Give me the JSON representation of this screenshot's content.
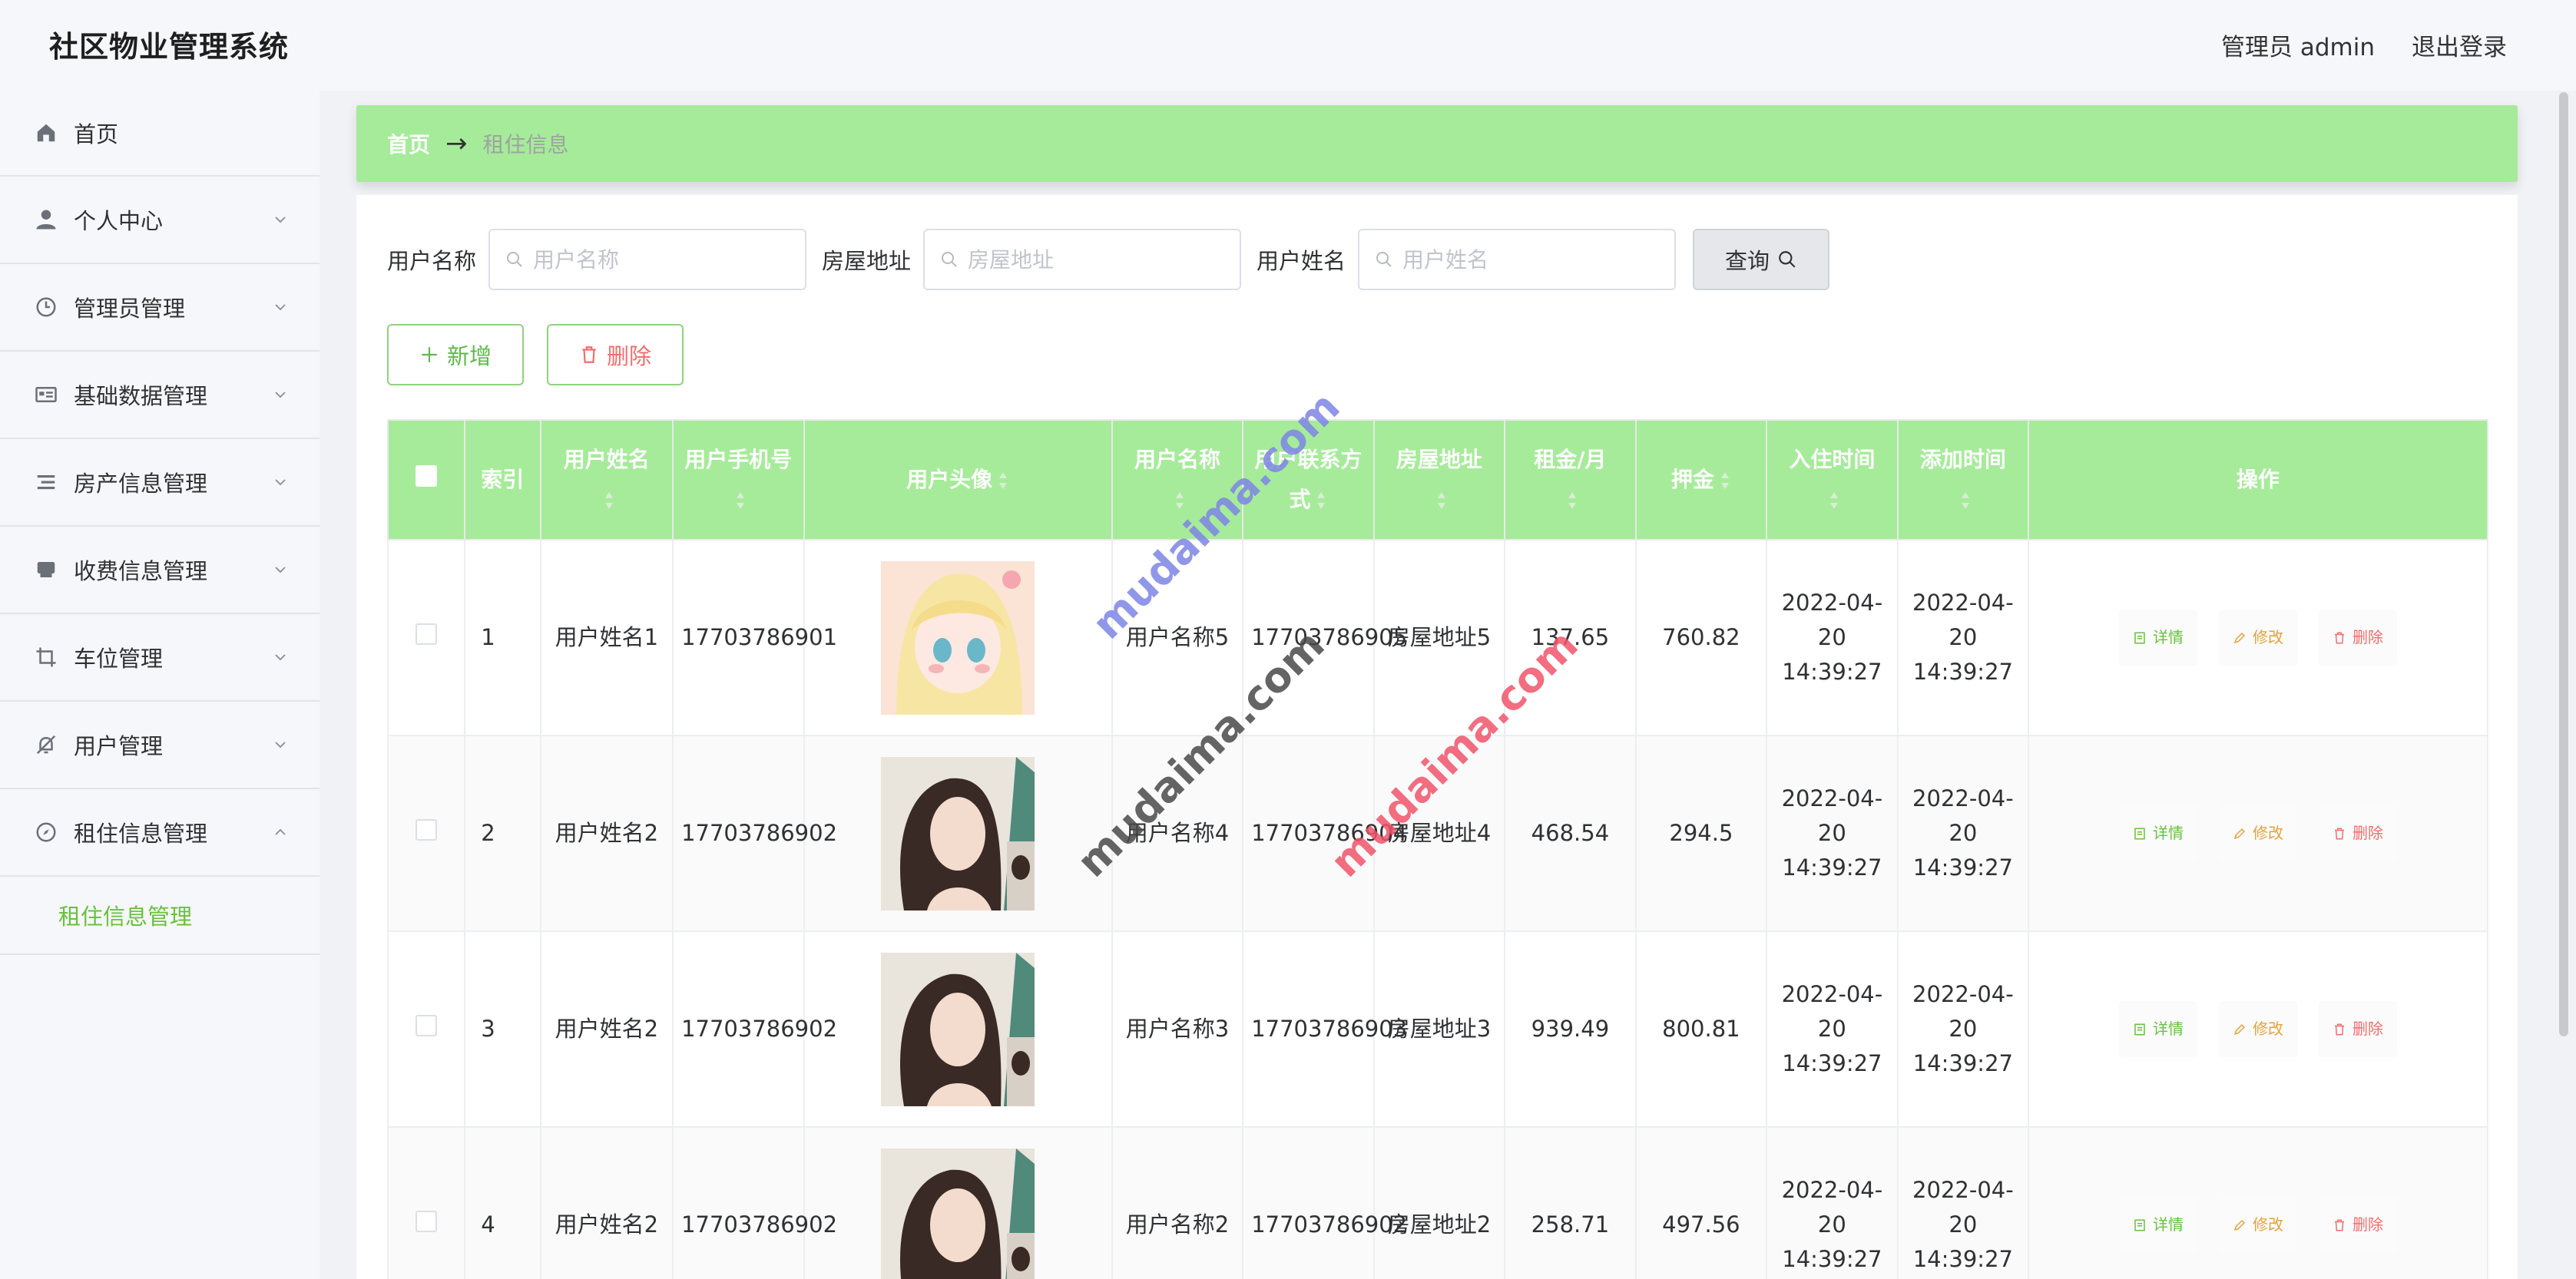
{
  "header": {
    "app_title": "社区物业管理系统",
    "user_label": "管理员 admin",
    "logout_label": "退出登录"
  },
  "sidebar": {
    "items": [
      {
        "label": "首页",
        "icon": "home-icon"
      },
      {
        "label": "个人中心",
        "icon": "user-icon"
      },
      {
        "label": "管理员管理",
        "icon": "clock-icon"
      },
      {
        "label": "基础数据管理",
        "icon": "id-card-icon"
      },
      {
        "label": "房产信息管理",
        "icon": "list-icon"
      },
      {
        "label": "收费信息管理",
        "icon": "printer-icon"
      },
      {
        "label": "车位管理",
        "icon": "crop-icon"
      },
      {
        "label": "用户管理",
        "icon": "bell-off-icon"
      },
      {
        "label": "租住信息管理",
        "icon": "compass-icon"
      }
    ],
    "sub_item": "租住信息管理"
  },
  "breadcrumb": {
    "home": "首页",
    "current": "租住信息"
  },
  "search": {
    "user_name_label": "用户名称",
    "user_name_placeholder": "用户名称",
    "address_label": "房屋地址",
    "address_placeholder": "房屋地址",
    "real_name_label": "用户姓名",
    "real_name_placeholder": "用户姓名",
    "query_label": "查询"
  },
  "actions": {
    "add_label": "新增",
    "delete_label": "删除"
  },
  "table": {
    "columns": {
      "index": "索引",
      "real_name": "用户姓名",
      "phone": "用户手机号",
      "avatar": "用户头像",
      "user_name": "用户名称",
      "contact": "用户联系方式",
      "address": "房屋地址",
      "rent": "租金/月",
      "deposit": "押金",
      "checkin": "入住时间",
      "added": "添加时间",
      "ops": "操作"
    },
    "rows": [
      {
        "index": "1",
        "real_name": "用户姓名1",
        "phone": "17703786901",
        "user_name": "用户名称5",
        "contact": "17703786905",
        "address": "房屋地址5",
        "rent": "137.65",
        "deposit": "760.82",
        "checkin": "2022-04-20 14:39:27",
        "added": "2022-04-20 14:39:27",
        "avatar": "anime-avatar"
      },
      {
        "index": "2",
        "real_name": "用户姓名2",
        "phone": "17703786902",
        "user_name": "用户名称4",
        "contact": "17703786904",
        "address": "房屋地址4",
        "rent": "468.54",
        "deposit": "294.5",
        "checkin": "2022-04-20 14:39:27",
        "added": "2022-04-20 14:39:27",
        "avatar": "portrait-avatar"
      },
      {
        "index": "3",
        "real_name": "用户姓名2",
        "phone": "17703786902",
        "user_name": "用户名称3",
        "contact": "17703786903",
        "address": "房屋地址3",
        "rent": "939.49",
        "deposit": "800.81",
        "checkin": "2022-04-20 14:39:27",
        "added": "2022-04-20 14:39:27",
        "avatar": "portrait-avatar"
      },
      {
        "index": "4",
        "real_name": "用户姓名2",
        "phone": "17703786902",
        "user_name": "用户名称2",
        "contact": "17703786902",
        "address": "房屋地址2",
        "rent": "258.71",
        "deposit": "497.56",
        "checkin": "2022-04-20 14:39:27",
        "added": "2022-04-20 14:39:27",
        "avatar": "portrait-avatar"
      }
    ],
    "op_detail": "详情",
    "op_edit": "修改",
    "op_delete": "删除"
  },
  "watermarks": [
    "mudaima.com",
    "mudaima.com",
    "mudaima.com"
  ],
  "colors": {
    "accent_green": "#a6eb9a",
    "detail_green": "#67c23a",
    "edit_orange": "#e6a23c",
    "delete_red": "#f56c6c"
  }
}
